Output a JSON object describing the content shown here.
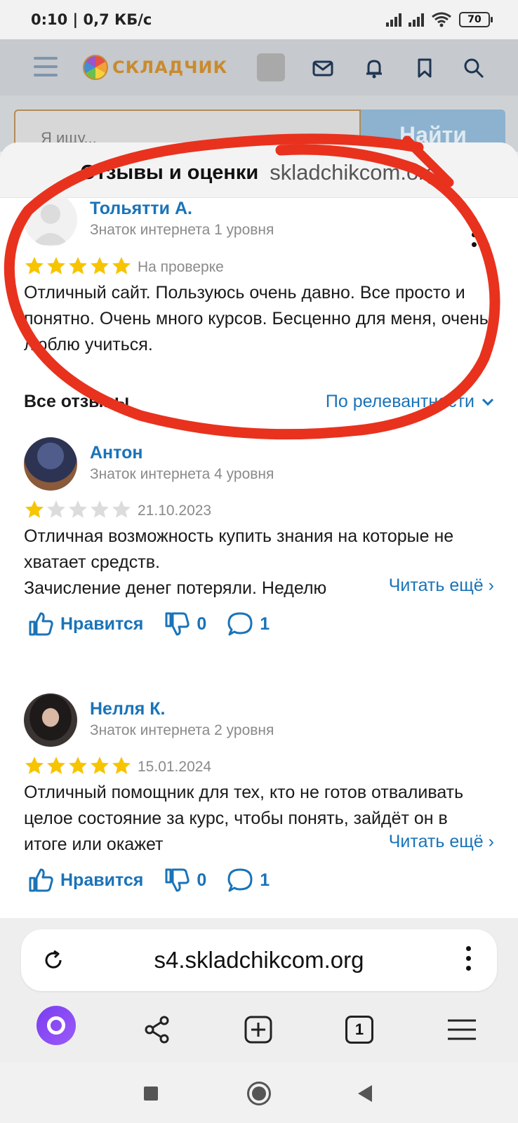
{
  "status_bar": {
    "time": "0:10 | 0,7 КБ/с",
    "battery": "70"
  },
  "site": {
    "logo_text": "СКЛАДЧИК",
    "search_placeholder": "Я ищу...",
    "search_button": "Найти",
    "brand_color": "#c98b2e"
  },
  "sheet": {
    "title": "Отзывы и оценки",
    "site": "skladchikcom.org"
  },
  "my_review": {
    "author": "Тольятти А.",
    "level": "Знаток интернета 1 уровня",
    "rating": 5,
    "status": "На проверке",
    "text": "Отличный сайт. Пользуюсь очень давно. Все просто и понятно. Очень много курсов. Бесценно для меня, очень люблю учиться."
  },
  "all_reviews": {
    "title": "Все отзывы",
    "sort_label": "По релевантности"
  },
  "reviews": [
    {
      "author": "Антон",
      "level": "Знаток интернета 4 уровня",
      "rating": 1,
      "date": "21.10.2023",
      "text": "Отличная возможность купить знания на которые не хватает средств.\nЗачисление денег потеряли. Неделю",
      "read_more": "Читать ещё ›",
      "like_label": "Нравится",
      "dislikes": "0",
      "comments": "1"
    },
    {
      "author": "Нелля К.",
      "level": "Знаток интернета 2 уровня",
      "rating": 5,
      "date": "15.01.2024",
      "text": "Отличный помощник для тех, кто не готов отваливать целое состояние за курс, чтобы понять, зайдёт он в итоге или окажет",
      "read_more": "Читать ещё ›",
      "like_label": "Нравится",
      "dislikes": "0",
      "comments": "1"
    }
  ],
  "browser": {
    "url": "s4.skladchikcom.org",
    "tabs_count": "1"
  },
  "colors": {
    "link": "#1a73b8",
    "star": "#f7c400",
    "star_empty": "#dcdcdc",
    "annotation": "#e8321e"
  }
}
